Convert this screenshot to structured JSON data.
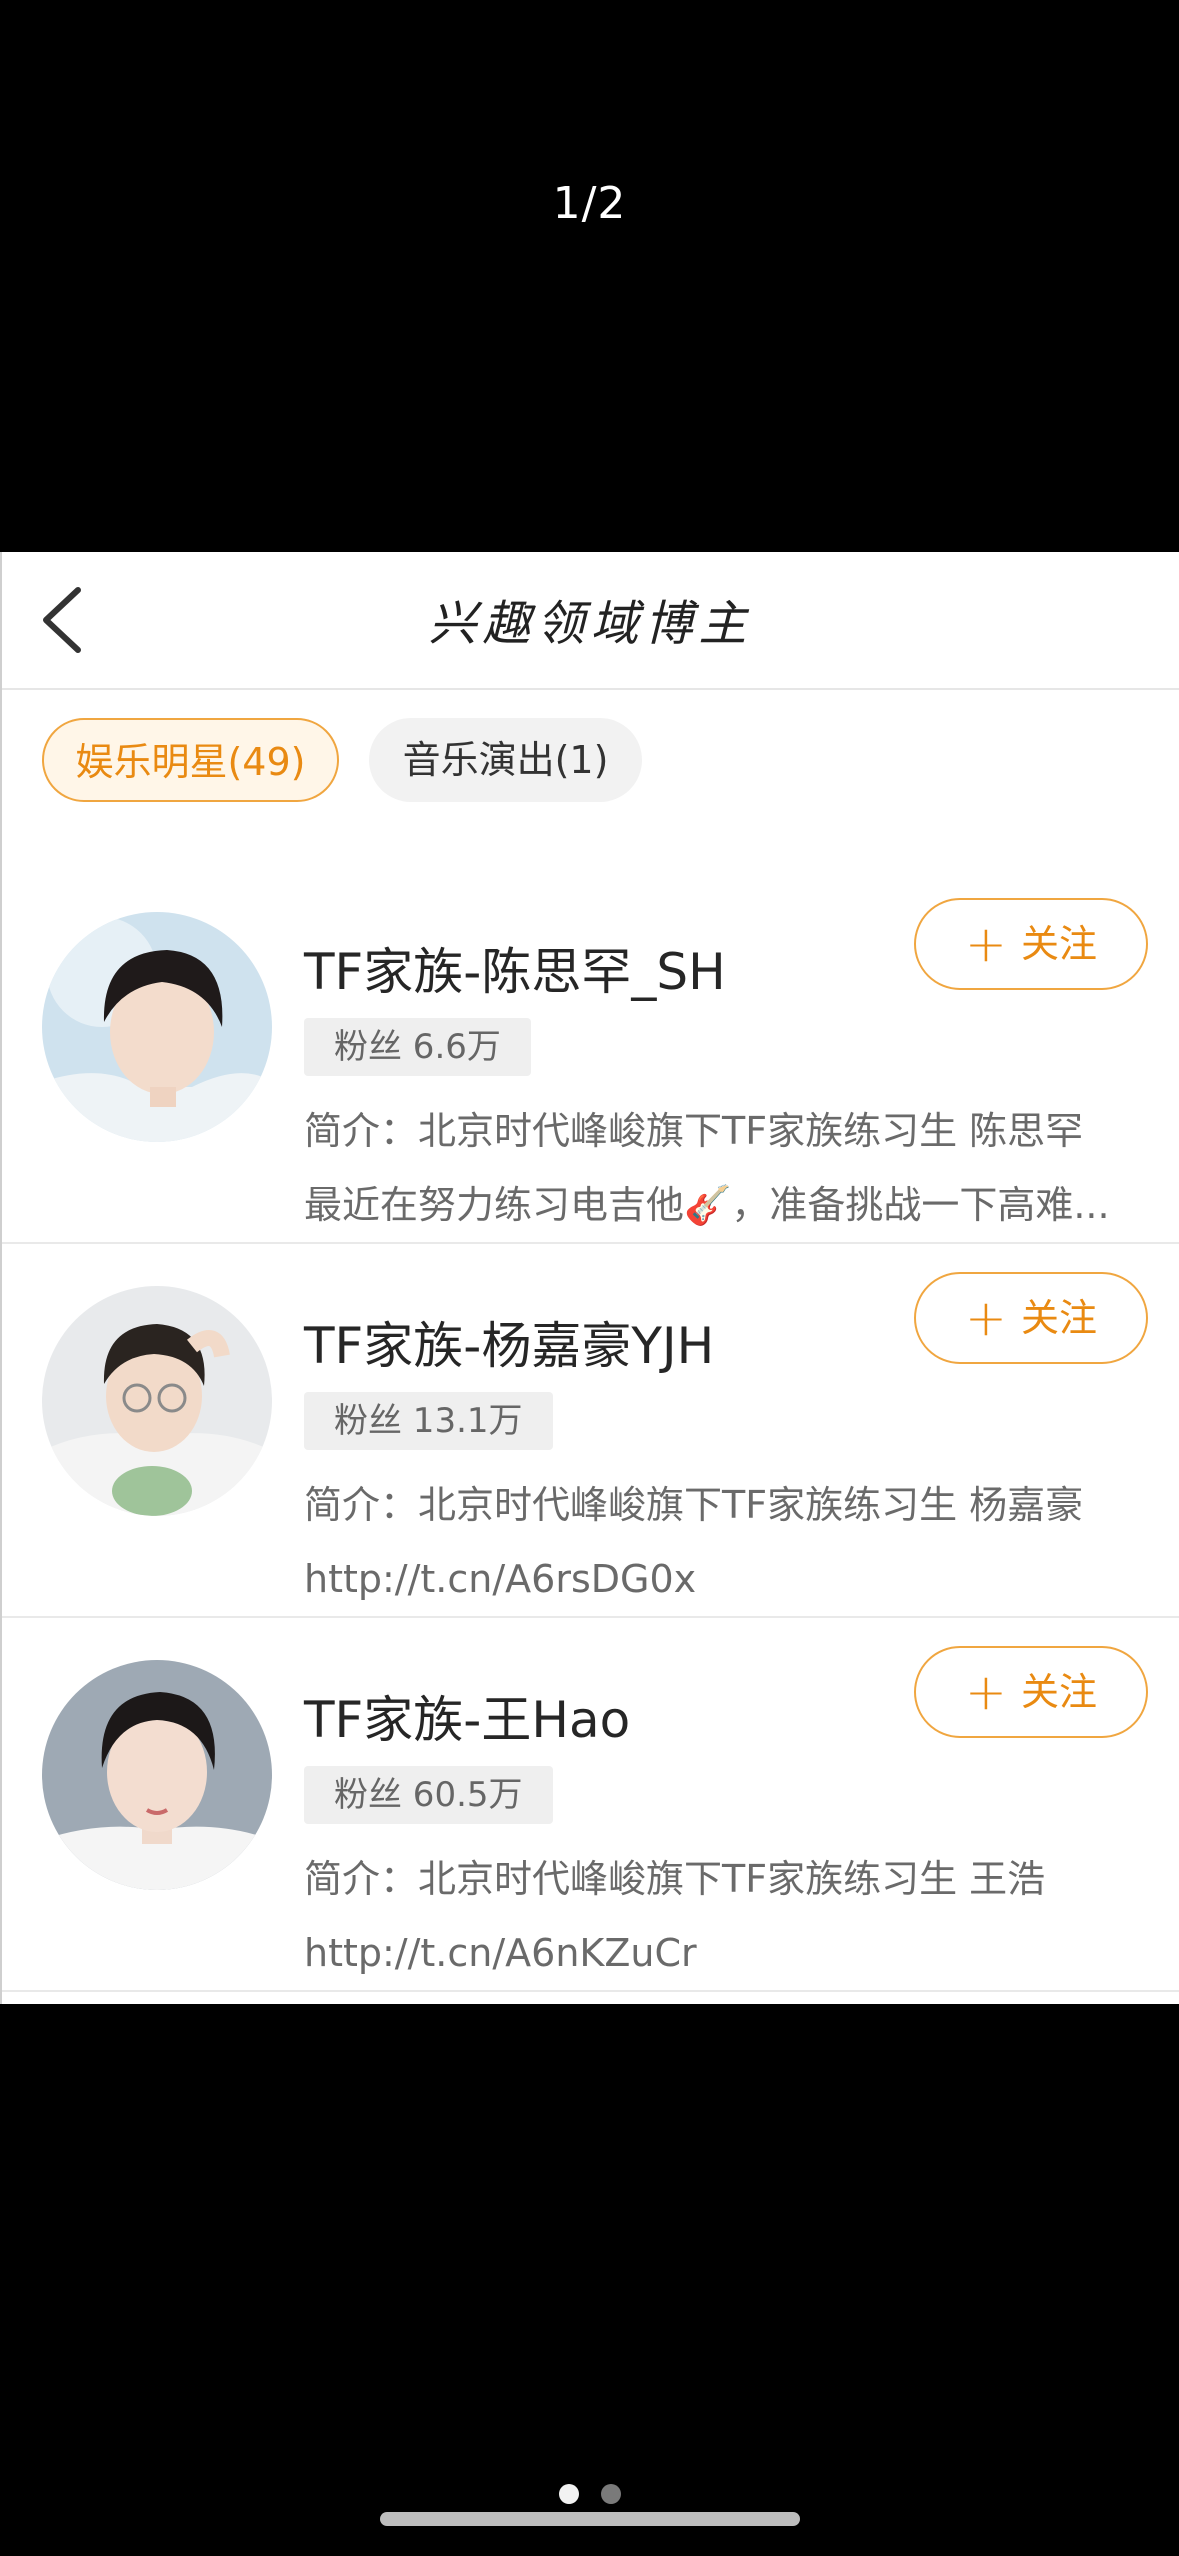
{
  "viewer": {
    "page_counter": "1/2"
  },
  "nav": {
    "back_icon": "chevron-left-icon",
    "title": "兴趣领域博主"
  },
  "tabs": [
    {
      "label": "娱乐明星(49)",
      "active": true
    },
    {
      "label": "音乐演出(1)",
      "active": false
    }
  ],
  "users": [
    {
      "name": "TF家族-陈思罕_SH",
      "fans": "粉丝 6.6万",
      "desc_line1": "简介：北京时代峰峻旗下TF家族练习生 陈思罕",
      "desc_line2": "最近在努力练习电吉他🎸，准备挑战一下高难...",
      "follow_label": "关注"
    },
    {
      "name": "TF家族-杨嘉豪YJH",
      "fans": "粉丝 13.1万",
      "desc_line1": "简介：北京时代峰峻旗下TF家族练习生 杨嘉豪",
      "desc_line2": "http://t.cn/A6rsDG0x",
      "follow_label": "关注"
    },
    {
      "name": "TF家族-王Hao",
      "fans": "粉丝 60.5万",
      "desc_line1": "简介：北京时代峰峻旗下TF家族练习生 王浩",
      "desc_line2": "http://t.cn/A6nKZuCr",
      "follow_label": "关注"
    }
  ],
  "follow_icon": "plus-icon",
  "pager": {
    "current": 1,
    "total": 2
  },
  "colors": {
    "accent": "#e98a12",
    "accent_border": "#f0a640",
    "background": "#000000"
  }
}
